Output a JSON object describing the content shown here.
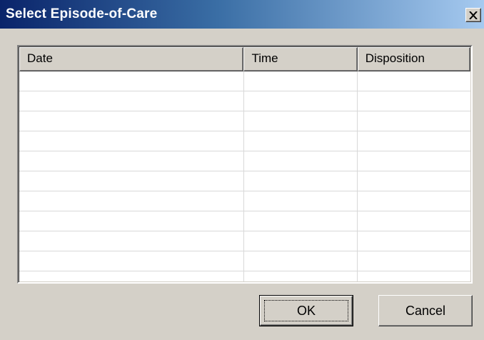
{
  "dialog": {
    "title": "Select Episode-of-Care",
    "close_glyph": "×"
  },
  "table": {
    "columns": [
      {
        "label": "Date"
      },
      {
        "label": "Time"
      },
      {
        "label": "Disposition"
      }
    ],
    "rows": []
  },
  "buttons": {
    "ok_label": "OK",
    "cancel_label": "Cancel"
  },
  "colors": {
    "titlebar_start": "#0a246a",
    "titlebar_end": "#a6caf0",
    "dialog_face": "#d4d0c8"
  }
}
